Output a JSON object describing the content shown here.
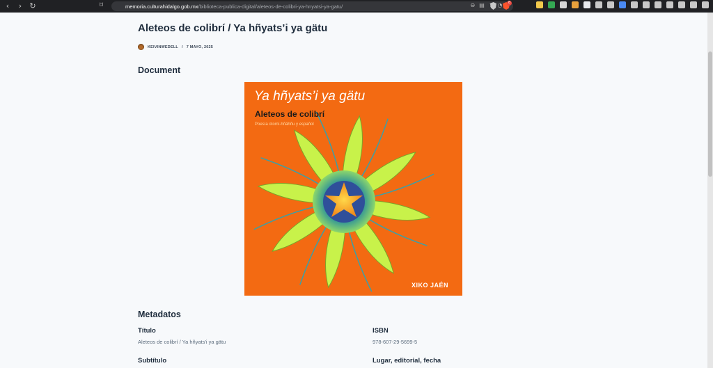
{
  "browser": {
    "url_host": "memoria.culturahidalgo.gob.mx",
    "url_path": "/biblioteca-publica-digital/aleteos-de-colibri-ya-hnyatsi-ya-gatu/",
    "brave_badge": "8"
  },
  "post": {
    "title": "Aleteos de colibrí / Ya hñyats’i ya gätu",
    "author": "KEIVINWEDELL",
    "separator": "/",
    "date": "7 MAYO, 2025"
  },
  "document_heading": "Document",
  "cover": {
    "title_otomi": "Ya hñyats’i ya gätu",
    "title_es": "Aleteos de colibrí",
    "subtitle": "Poesía otomí-hñähñu y español",
    "author": "XIKO JAÉN",
    "colors": {
      "background": "#f36a12",
      "petals": "#c8f24a",
      "center": "#f7b22a",
      "rings": "#2a8f9a"
    }
  },
  "metadata": {
    "heading": "Metadatos",
    "fields": [
      {
        "label": "Título",
        "value": "Aleteos de colibrí / Ya hñyats'i ya gätu"
      },
      {
        "label": "ISBN",
        "value": "978-607-29-5699-5"
      },
      {
        "label": "Subtítulo",
        "value": ""
      },
      {
        "label": "Lugar, editorial, fecha",
        "value": ""
      }
    ]
  }
}
